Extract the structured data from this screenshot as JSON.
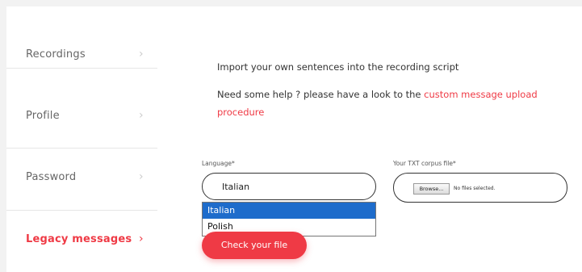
{
  "sidebar": {
    "items": [
      {
        "label": "Recordings",
        "chevron": "›"
      },
      {
        "label": "Profile",
        "chevron": "›"
      },
      {
        "label": "Password",
        "chevron": "›"
      },
      {
        "label": "Legacy messages",
        "chevron": "›"
      }
    ],
    "active_color": "#ef3a45"
  },
  "main": {
    "intro": "Import your own sentences into the recording script",
    "help_prefix": "Need some help ? please have a look to the ",
    "help_link": "custom message upload procedure",
    "language": {
      "label": "Language*",
      "value": "Italian",
      "options": [
        "Italian",
        "Polish"
      ]
    },
    "corpus": {
      "label": "Your TXT corpus file*",
      "browse": "Browse...",
      "no_file": "No files selected."
    },
    "check_button": "Check your file"
  },
  "colors": {
    "accent": "#ef3a45",
    "selected_option": "#1e6ccb"
  }
}
